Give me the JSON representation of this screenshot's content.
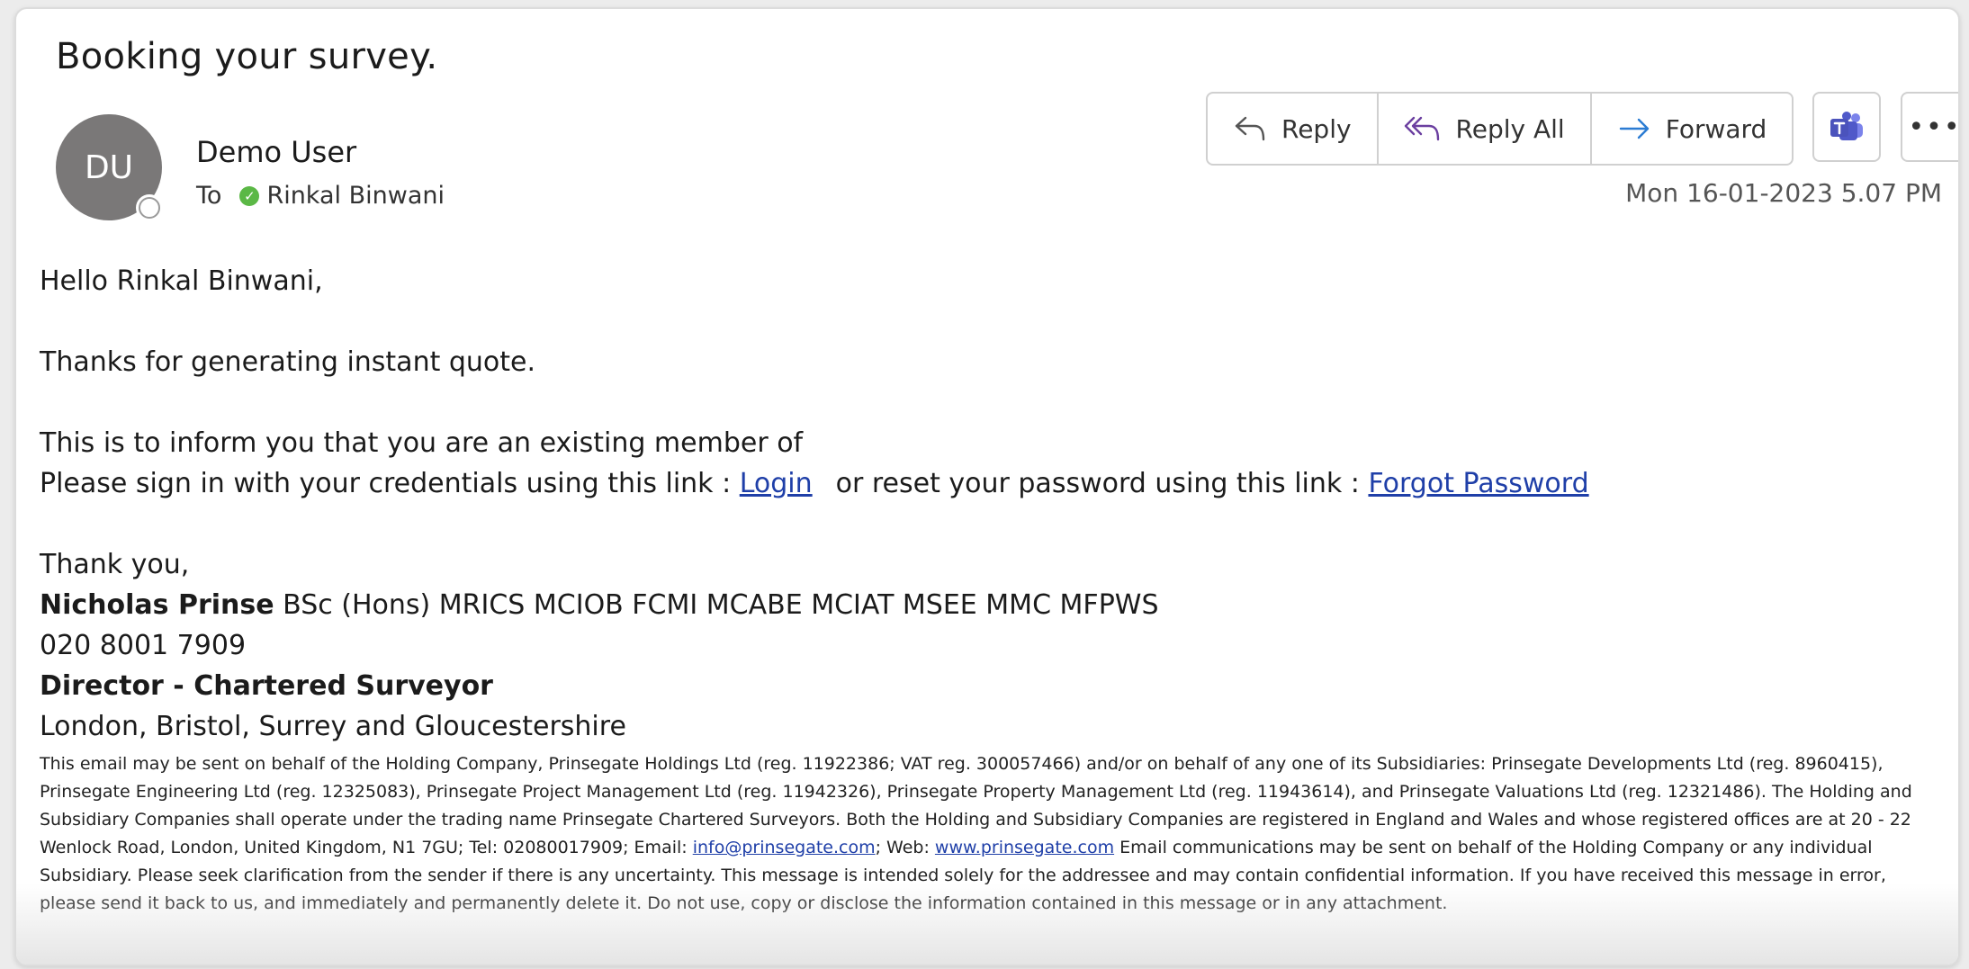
{
  "email": {
    "subject": "Booking your survey.",
    "sender": {
      "name": "Demo User",
      "initials": "DU"
    },
    "to_label": "To",
    "recipient": "Rinkal Binwani",
    "timestamp": "Mon 16-01-2023 5.07 PM"
  },
  "actions": {
    "reply": "Reply",
    "reply_all": "Reply All",
    "forward": "Forward",
    "teams_icon": "teams-icon",
    "more": "•••"
  },
  "body": {
    "greeting": "Hello Rinkal Binwani,",
    "thanks_line": "Thanks for generating instant quote.",
    "member_line": "This is to inform you that you are an existing member of",
    "signin_prefix": "Please sign in with your credentials using this link : ",
    "login_link": "Login",
    "reset_prefix": "or reset your password using this link : ",
    "forgot_link": "Forgot Password",
    "closing": "Thank you,"
  },
  "signature": {
    "name": "Nicholas Prinse",
    "credentials": "BSc (Hons) MRICS MCIOB FCMI MCABE MCIAT MSEE MMC MFPWS",
    "phone": "020 8001 7909",
    "title": "Director - Chartered Surveyor",
    "locations": "London, Bristol, Surrey and Gloucestershire"
  },
  "disclaimer": {
    "part1": "This email may be sent on behalf of the Holding Company, Prinsegate Holdings Ltd (reg. 11922386; VAT reg. 300057466) and/or on behalf of any one of its Subsidiaries: Prinsegate Developments Ltd (reg. 8960415), Prinsegate Engineering Ltd (reg. 12325083), Prinsegate Project Management Ltd (reg. 11942326), Prinsegate Property Management Ltd (reg. 11943614), and Prinsegate Valuations Ltd (reg. 12321486). The Holding and Subsidiary Companies shall operate under the trading name Prinsegate Chartered Surveyors. Both the Holding and Subsidiary Companies are registered in England and Wales and whose registered offices are at 20 - 22 Wenlock Road, London, United Kingdom, N1 7GU; Tel: 02080017909; Email: ",
    "email_link": "info@prinsegate.com",
    "part2": "; Web: ",
    "web_link": "www.prinsegate.com",
    "part3": " Email communications may be sent on behalf of the Holding Company or any individual Subsidiary. Please seek clarification from the sender if there is any uncertainty. This message is intended solely for the addressee and may contain confidential information. If you have received this message in error, please send it back to us, and immediately and permanently delete it. Do not use, copy or disclose the information contained in this message or in any attachment."
  },
  "colors": {
    "link": "#1f3fa8",
    "avatar_bg": "#7a7878",
    "presence_green": "#5bb846",
    "reply_icon": "#555555",
    "reply_all_icon": "#6b3fa0",
    "forward_icon": "#2b7cd3",
    "teams": "#4b53bc"
  }
}
